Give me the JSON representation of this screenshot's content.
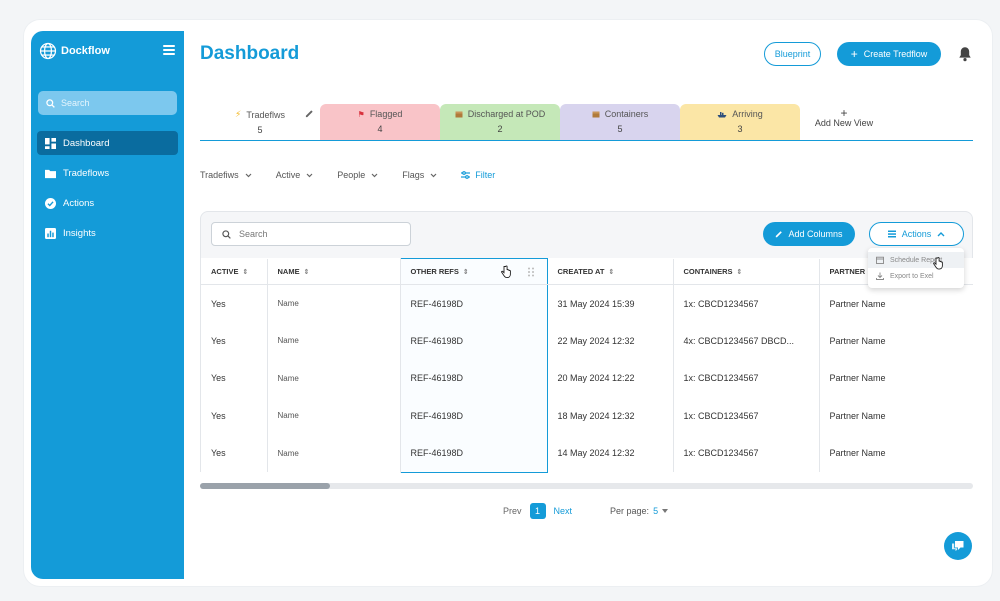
{
  "app": {
    "name": "Dockflow"
  },
  "sidebar": {
    "search_placeholder": "Search",
    "items": [
      {
        "label": "Dashboard",
        "icon": "dashboard-icon",
        "active": true
      },
      {
        "label": "Tradeflows",
        "icon": "folder-icon",
        "active": false
      },
      {
        "label": "Actions",
        "icon": "check-circle-icon",
        "active": false
      },
      {
        "label": "Insights",
        "icon": "chart-icon",
        "active": false
      }
    ]
  },
  "header": {
    "title": "Dashboard",
    "blueprint_label": "Blueprint",
    "create_label": "Create Tredflow"
  },
  "tabs": [
    {
      "label": "Tradeflws",
      "count": "5",
      "icon": "bolt-icon",
      "color": "#ffffff"
    },
    {
      "label": "Flagged",
      "count": "4",
      "icon": "flag-icon",
      "color": "#f9c4c8"
    },
    {
      "label": "Discharged at POD",
      "count": "2",
      "icon": "box-icon",
      "color": "#c5e8b8"
    },
    {
      "label": "Containers",
      "count": "5",
      "icon": "box-icon",
      "color": "#d8d4ee"
    },
    {
      "label": "Arriving",
      "count": "3",
      "icon": "ship-icon",
      "color": "#fbe6a6"
    }
  ],
  "add_view_label": "Add New View",
  "filters": {
    "items": [
      "Tradefiws",
      "Active",
      "People",
      "Flags"
    ],
    "filter_label": "Filter"
  },
  "table": {
    "search_placeholder": "Search",
    "add_columns_label": "Add Columns",
    "actions_label": "Actions",
    "columns": [
      "ACTIVE",
      "NAME",
      "OTHER REFS",
      "CREATED AT",
      "CONTAINERS",
      "PARTNER"
    ],
    "rows": [
      [
        "Yes",
        "Name",
        "REF-46198D",
        "31 May 2024  15:39",
        "1x: CBCD1234567",
        "Partner Name"
      ],
      [
        "Yes",
        "Name",
        "REF-46198D",
        "22 May 2024  12:32",
        "4x: CBCD1234567 DBCD...",
        "Partner Name"
      ],
      [
        "Yes",
        "Name",
        "REF-46198D",
        "20 May 2024  12:22",
        "1x: CBCD1234567",
        "Partner Name"
      ],
      [
        "Yes",
        "Name",
        "REF-46198D",
        "18 May 2024  12:32",
        "1x: CBCD1234567",
        "Partner Name"
      ],
      [
        "Yes",
        "Name",
        "REF-46198D",
        "14 May 2024  12:32",
        "1x: CBCD1234567",
        "Partner Name"
      ]
    ]
  },
  "actions_menu": {
    "items": [
      "Schedule Report",
      "Export to Exel"
    ]
  },
  "pagination": {
    "prev": "Prev",
    "current": "1",
    "next": "Next",
    "per_page_label": "Per page:",
    "per_page_value": "5"
  },
  "colors": {
    "accent": "#149bd8",
    "sidebar_active": "#0a6c9f"
  }
}
